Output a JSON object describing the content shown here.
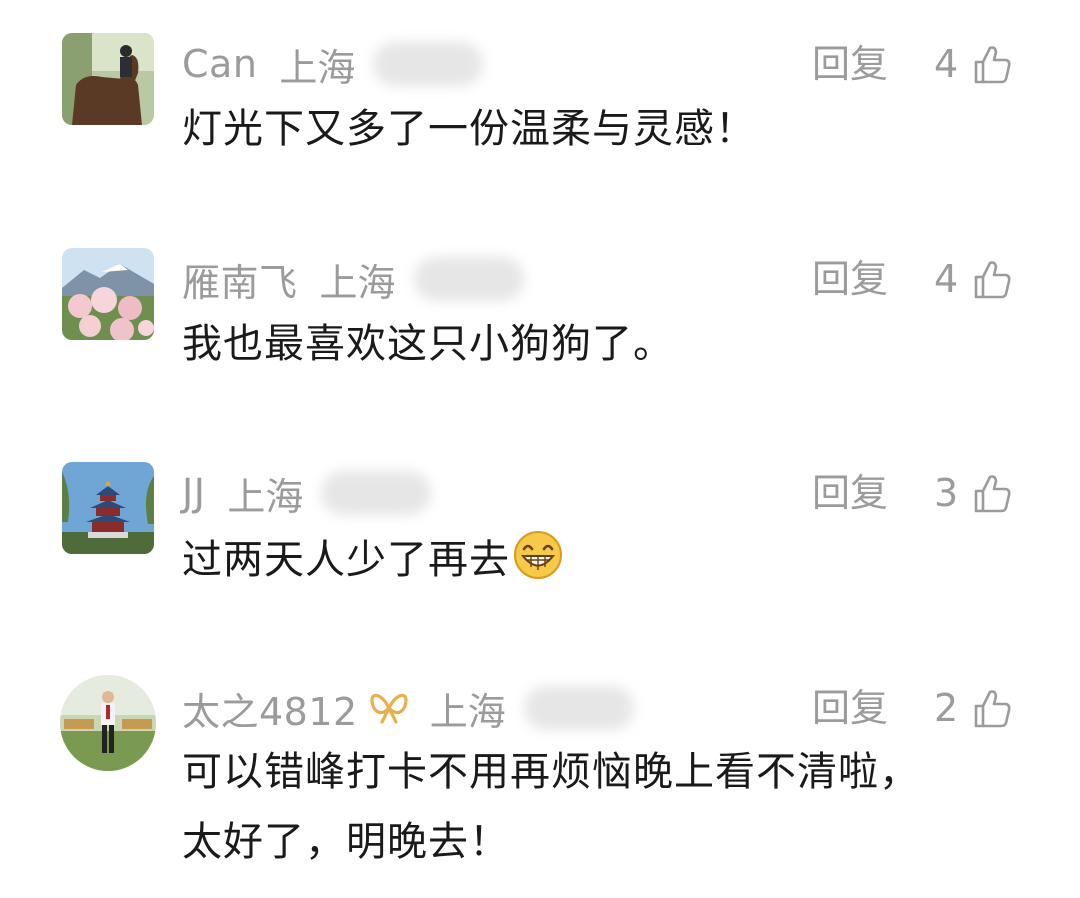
{
  "comments": [
    {
      "user": "Can",
      "location": "上海",
      "reply_label": "回复",
      "likes": "4",
      "lines": [
        "灯光下又多了一份温柔与灵感！"
      ]
    },
    {
      "user": "雁南飞",
      "location": "上海",
      "reply_label": "回复",
      "likes": "4",
      "lines": [
        "我也最喜欢这只小狗狗了。"
      ]
    },
    {
      "user": "JJ",
      "location": "上海",
      "reply_label": "回复",
      "likes": "3",
      "lines": [
        "过两天人少了再去"
      ],
      "emoji": "grinning-face-emoji"
    },
    {
      "user": "太之4812",
      "location": "上海",
      "reply_label": "回复",
      "likes": "2",
      "badge": "vip-ribbon-icon",
      "lines": [
        "可以错峰打卡不用再烦恼晚上看不清啦，",
        "太好了，明晚去！"
      ]
    }
  ],
  "colors": {
    "meta_text": "#9b9b9b",
    "body_text": "#1a1a1a",
    "badge": "#e8b04a",
    "background": "#ffffff"
  }
}
